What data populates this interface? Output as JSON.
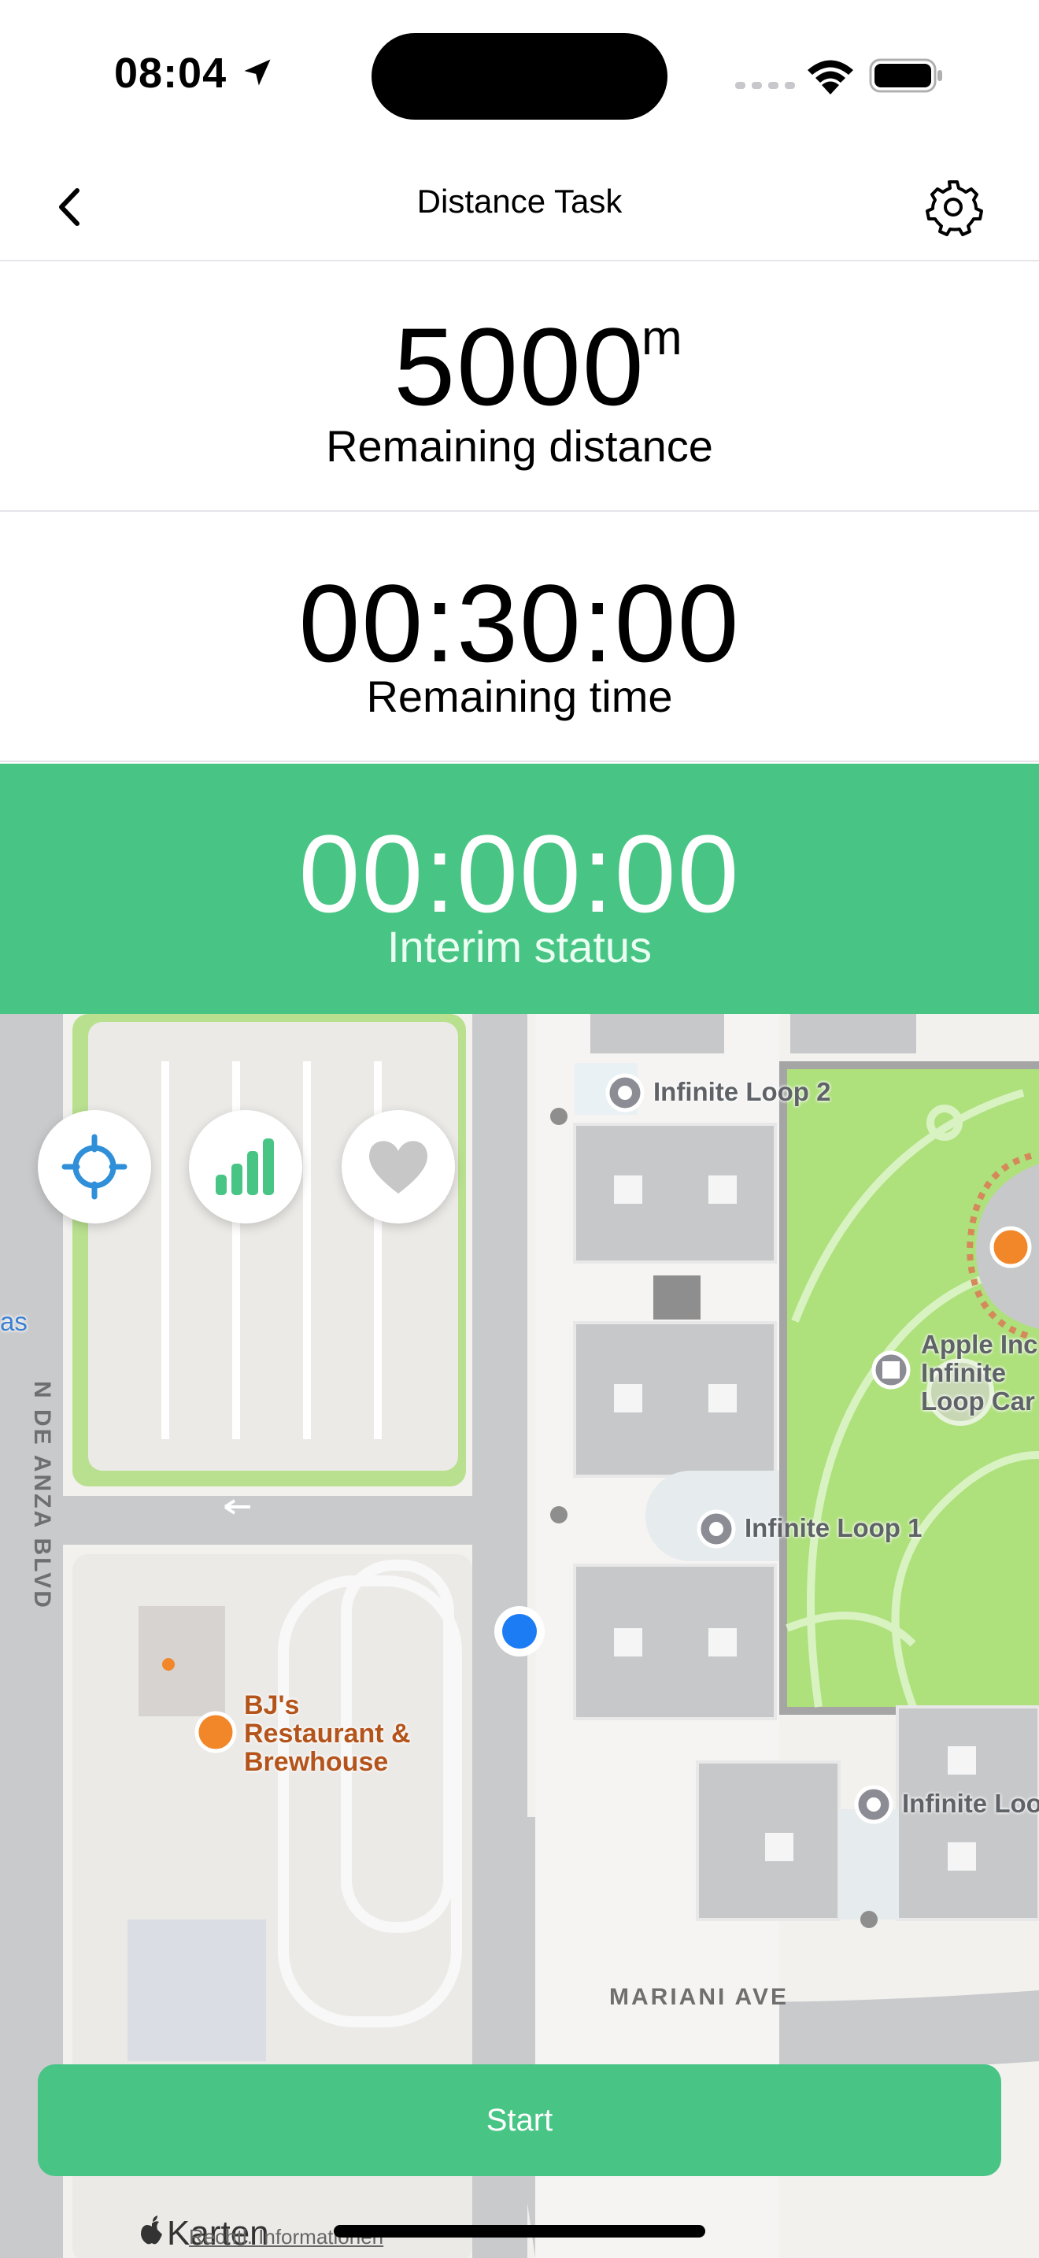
{
  "status_bar": {
    "time": "08:04"
  },
  "nav": {
    "title": "Distance Task"
  },
  "distance": {
    "value": "5000",
    "unit": "m",
    "label": "Remaining distance"
  },
  "time": {
    "value": "00:30:00",
    "label": "Remaining time"
  },
  "interim": {
    "value": "00:00:00",
    "label": "Interim status",
    "color": "#48c585"
  },
  "map": {
    "pois": [
      {
        "name": "Infinite Loop 2"
      },
      {
        "name": "Infinite Loop 1"
      },
      {
        "name": "Apple Inc"
      },
      {
        "name": "Infinite"
      },
      {
        "name": "Loop Car"
      },
      {
        "name": "Infinite Loo"
      }
    ],
    "restaurant": {
      "line1": "BJ's",
      "line2": "Restaurant &",
      "line3": "Brewhouse"
    },
    "streets": {
      "vertical": "N DE ANZA BLVD",
      "horizontal": "MARIANI AVE",
      "edge": "as"
    },
    "attribution": "Karten",
    "legal": "Rechtl. Informationen"
  },
  "actions": {
    "start_label": "Start",
    "color": "#48c585"
  },
  "icons": {
    "locate": "crosshair-icon",
    "signal": "signal-bars-icon",
    "favorite": "heart-icon",
    "settings": "gear-icon",
    "back": "chevron-left-icon"
  }
}
